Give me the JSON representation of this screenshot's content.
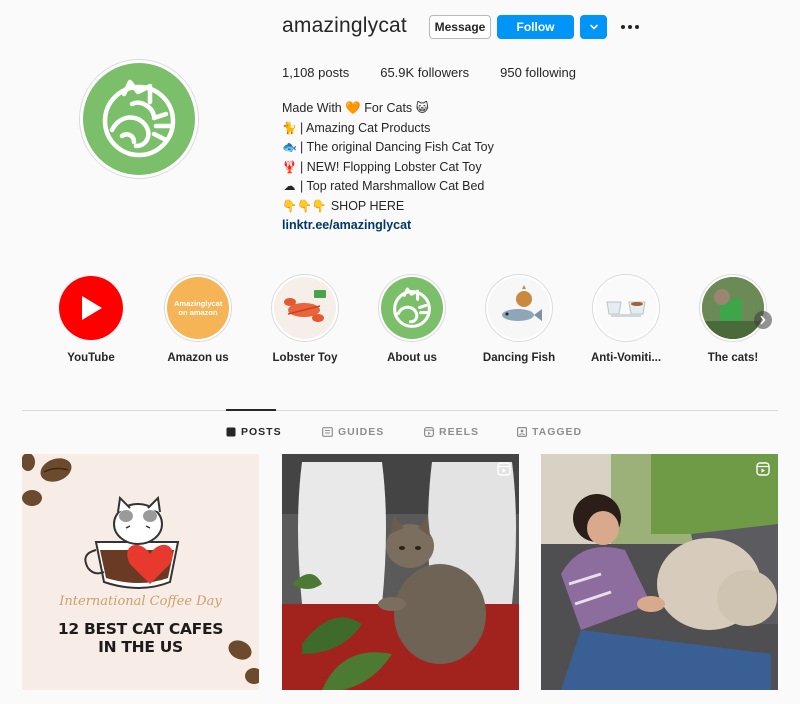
{
  "profile": {
    "username": "amazinglycat",
    "message_label": "Message",
    "follow_label": "Follow",
    "stats": {
      "posts": "1,108 posts",
      "followers": "65.9K followers",
      "following": "950 following"
    },
    "bio": [
      {
        "emoji": "",
        "text": "Made With 🧡 For Cats 😺"
      },
      {
        "emoji": "🐈",
        "text": "| Amazing Cat Products"
      },
      {
        "emoji": "🐟",
        "text": "| The original Dancing Fish Cat Toy"
      },
      {
        "emoji": "🦞",
        "text": "| NEW! Flopping Lobster Cat Toy"
      },
      {
        "emoji": "☁",
        "text": "| Top rated Marshmallow Cat Bed"
      },
      {
        "emoji": "👇👇👇",
        "text": "SHOP HERE"
      }
    ],
    "link": "linktr.ee/amazinglycat"
  },
  "highlights": [
    {
      "label": "YouTube",
      "icon": "youtube-play-icon"
    },
    {
      "label": "Amazon us",
      "icon": "amazon-badge",
      "badge_text": "Amazinglycat on amazon"
    },
    {
      "label": "Lobster Toy",
      "icon": "lobster-image"
    },
    {
      "label": "About us",
      "icon": "cat-logo"
    },
    {
      "label": "Dancing Fish",
      "icon": "fish-image"
    },
    {
      "label": "Anti-Vomiti...",
      "icon": "bowl-image"
    },
    {
      "label": "The cats!",
      "icon": "cat-photo"
    }
  ],
  "tabs": [
    {
      "label": "POSTS",
      "icon": "grid-icon",
      "active": true
    },
    {
      "label": "GUIDES",
      "icon": "guides-icon",
      "active": false
    },
    {
      "label": "REELS",
      "icon": "reels-icon",
      "active": false
    },
    {
      "label": "TAGGED",
      "icon": "tagged-icon",
      "active": false
    }
  ],
  "posts": [
    {
      "script_text": "International Coffee Day",
      "title_line1": "12 BEST CAT CAFES",
      "title_line2": "IN THE US"
    },
    {
      "type": "reel"
    },
    {
      "type": "reel"
    }
  ],
  "colors": {
    "accent": "#0095f6",
    "logo_green": "#7cbf6a",
    "youtube_red": "#ff0000",
    "amazon_orange": "#f5b455",
    "link": "#00376b"
  }
}
